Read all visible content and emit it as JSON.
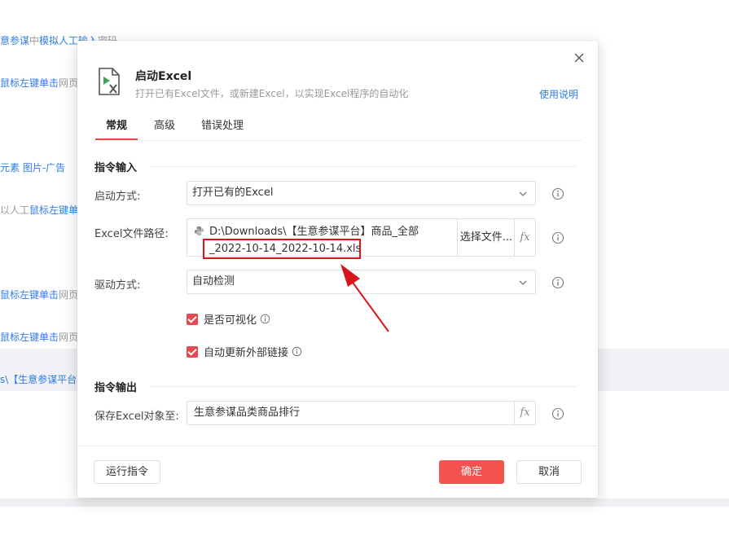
{
  "background": {
    "lines": [
      {
        "pre": "意参谋",
        "mid": "中",
        "blue": "模拟人工输入",
        "post": "密码"
      },
      {
        "pre": "",
        "mid": "",
        "blue": "鼠标左键单击",
        "post": "网页"
      },
      {
        "pre": "",
        "mid": "",
        "blue": "元素 图片-广告",
        "post": ""
      },
      {
        "pre": "以人工",
        "mid": "",
        "blue": "鼠标左键单击",
        "post": ""
      },
      {
        "pre": "",
        "mid": "",
        "blue": "鼠标左键单击",
        "post": "网页"
      },
      {
        "pre": "",
        "mid": "",
        "blue": "鼠标左键单击",
        "post": "网页"
      },
      {
        "pre": "",
        "mid": "",
        "blue": "s\\【生意参谋平台",
        "post": ""
      }
    ]
  },
  "dialog": {
    "title": "启动Excel",
    "subtitle": "打开已有Excel文件，或新建Excel，以实现Excel程序的自动化",
    "help_link": "使用说明",
    "tabs": [
      {
        "label": "常规",
        "active": true
      },
      {
        "label": "高级",
        "active": false
      },
      {
        "label": "错误处理",
        "active": false
      }
    ],
    "input_section": "指令输入",
    "output_section": "指令输出",
    "launch_mode": {
      "label": "启动方式:",
      "value": "打开已有的Excel"
    },
    "file_path": {
      "label": "Excel文件路径:",
      "line1": "D:\\Downloads\\【生意参谋平台】商品_全部",
      "line2": "_2022-10-14_2022-10-14.xls",
      "choose_button": "选择文件...",
      "fx": "fx"
    },
    "driver_mode": {
      "label": "驱动方式:",
      "value": "自动检测"
    },
    "checkboxes": [
      {
        "label": "是否可视化",
        "checked": true
      },
      {
        "label": "自动更新外部链接",
        "checked": true
      }
    ],
    "save_to": {
      "label": "保存Excel对象至:",
      "value": "生意参谋品类商品排行",
      "fx": "fx"
    },
    "buttons": {
      "run": "运行指令",
      "ok": "确定",
      "cancel": "取消"
    }
  },
  "colors": {
    "accent": "#e8474b",
    "link": "#2f7de1",
    "annotation": "#d8141c"
  }
}
